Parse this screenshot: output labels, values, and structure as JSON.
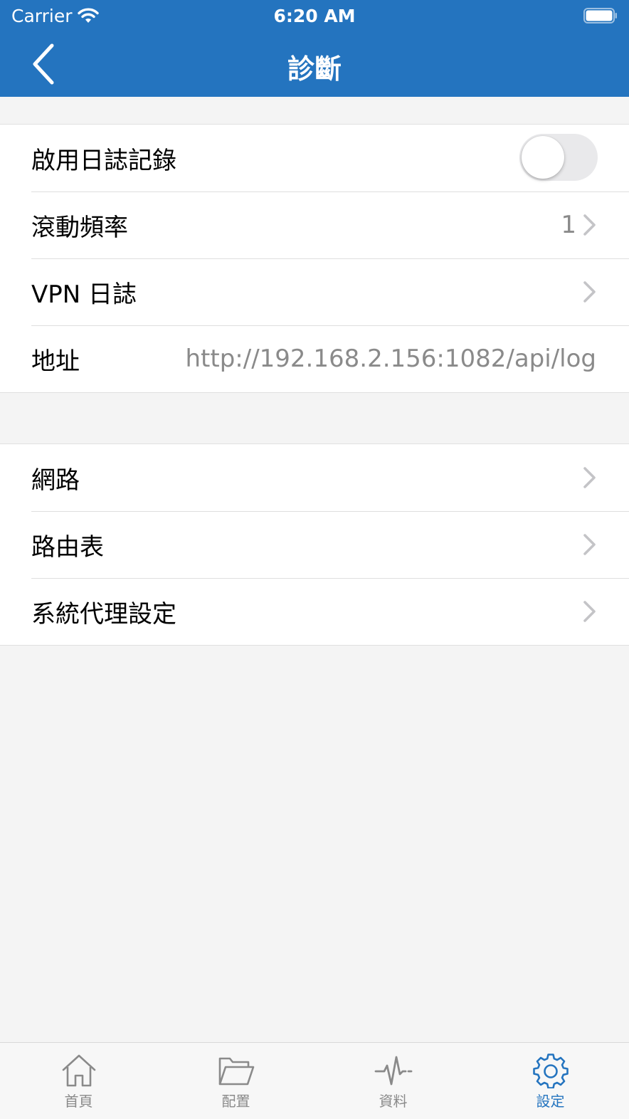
{
  "status_bar": {
    "carrier": "Carrier",
    "time": "6:20 AM"
  },
  "nav": {
    "title": "診斷"
  },
  "section1": {
    "logging_label": "啟用日誌記錄",
    "logging_enabled": false,
    "rotation_label": "滾動頻率",
    "rotation_value": "1",
    "vpn_log_label": "VPN 日誌",
    "address_label": "地址",
    "address_value": "http://192.168.2.156:1082/api/log"
  },
  "section2": {
    "network_label": "網路",
    "route_table_label": "路由表",
    "system_proxy_label": "系統代理設定"
  },
  "tabs": [
    {
      "label": "首頁",
      "icon": "home-icon"
    },
    {
      "label": "配置",
      "icon": "folder-icon"
    },
    {
      "label": "資料",
      "icon": "activity-icon"
    },
    {
      "label": "設定",
      "icon": "gear-icon"
    }
  ],
  "colors": {
    "accent": "#2474bf",
    "background": "#f4f4f4",
    "secondary_text": "#8a8a8a"
  }
}
